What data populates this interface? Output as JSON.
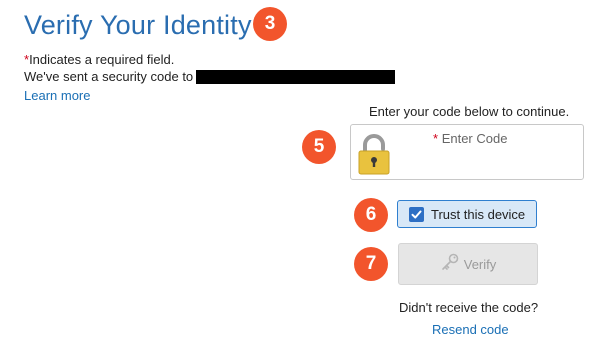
{
  "header": {
    "title": "Verify Your Identity",
    "step_badge": "3"
  },
  "intro": {
    "required_star": "*",
    "required_note": "Indicates a required field.",
    "sent_text": "We've sent a security code to",
    "learn_more": "Learn more"
  },
  "code_entry": {
    "instruction": "Enter your code below to continue.",
    "step_badge": "5",
    "required_star": "*",
    "field_label": "Enter Code",
    "field_value": "",
    "icon": "padlock-icon"
  },
  "trust": {
    "step_badge": "6",
    "label": "Trust this device",
    "checked": true
  },
  "verify": {
    "step_badge": "7",
    "label": "Verify",
    "icon": "key-icon",
    "enabled": false
  },
  "resend": {
    "prompt": "Didn't receive the code?",
    "link": "Resend code"
  },
  "colors": {
    "title": "#2a6db0",
    "link": "#1a6fb5",
    "badge": "#f2552c",
    "required": "#d0021b",
    "checkbox": "#2d6fc4",
    "trust_bg": "#d8e8f7",
    "button_disabled": "#e6e6e6"
  }
}
